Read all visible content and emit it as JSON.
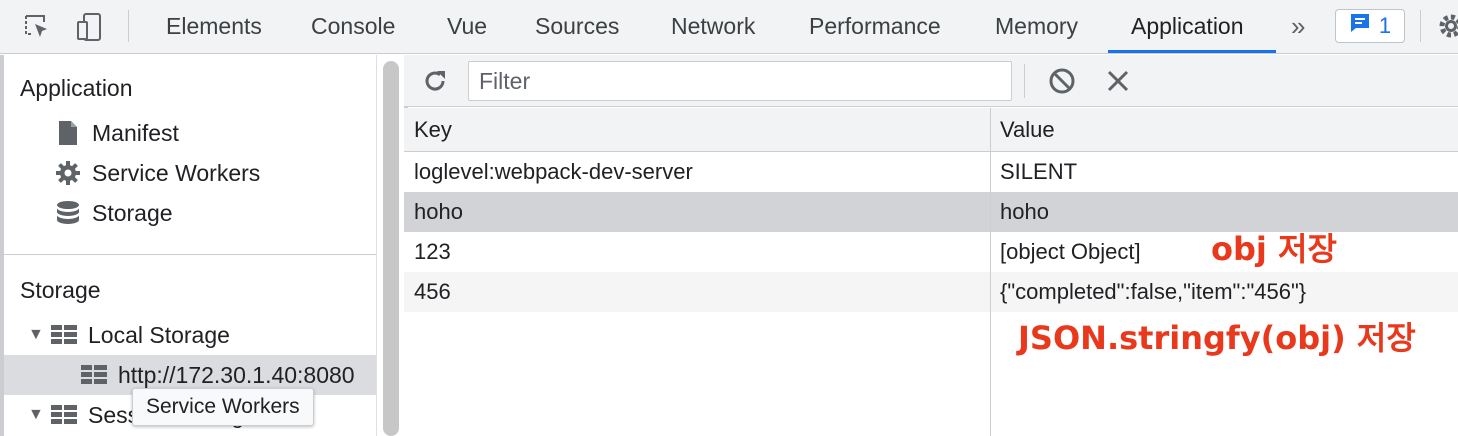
{
  "tabs": [
    {
      "label": "Elements"
    },
    {
      "label": "Console"
    },
    {
      "label": "Vue"
    },
    {
      "label": "Sources"
    },
    {
      "label": "Network"
    },
    {
      "label": "Performance"
    },
    {
      "label": "Memory"
    },
    {
      "label": "Application"
    }
  ],
  "more_label": "»",
  "issues_count": "1",
  "sidebar": {
    "application_title": "Application",
    "app_items": [
      {
        "label": "Manifest",
        "icon": "document-icon"
      },
      {
        "label": "Service Workers",
        "icon": "gear-icon"
      },
      {
        "label": "Storage",
        "icon": "database-icon"
      }
    ],
    "storage_title": "Storage",
    "local_storage": "Local Storage",
    "local_origin": "http://172.30.1.40:8080",
    "session_storage": "Session Storage",
    "tooltip": "Service Workers"
  },
  "toolbar": {
    "filter_placeholder": "Filter"
  },
  "table": {
    "headers": {
      "key": "Key",
      "value": "Value"
    },
    "rows": [
      {
        "key": "loglevel:webpack-dev-server",
        "value": "SILENT"
      },
      {
        "key": "hoho",
        "value": "hoho"
      },
      {
        "key": "123",
        "value": "[object Object]"
      },
      {
        "key": "456",
        "value": "{\"completed\":false,\"item\":\"456\"}"
      }
    ]
  },
  "annotations": {
    "obj": "obj 저장",
    "json": "JSON.stringfy(obj) 저장"
  },
  "colors": {
    "accent": "#1a73e8",
    "annotation": "#e8391d",
    "selected_row": "#d1d3d7"
  }
}
